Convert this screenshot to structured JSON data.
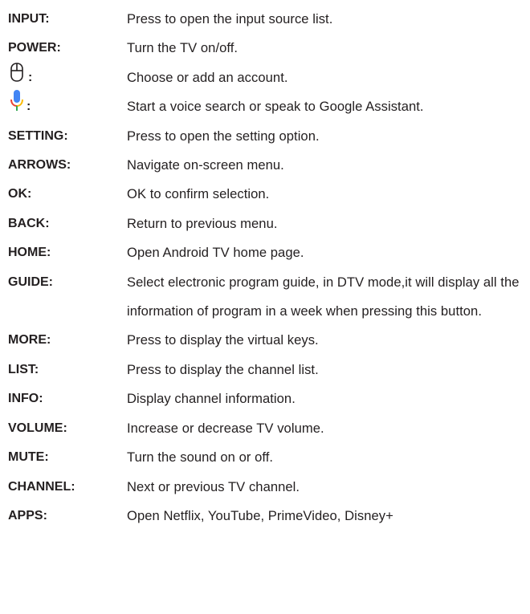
{
  "items": [
    {
      "term": "INPUT:",
      "desc": "Press to open the input source list."
    },
    {
      "term": "POWER:",
      "desc": "Turn the TV on/off."
    },
    {
      "term_icon": "account-icon",
      "term": ":",
      "desc": "Choose or add an account."
    },
    {
      "term_icon": "microphone-icon",
      "term": ":",
      "desc": "Start a voice search or speak to Google Assistant."
    },
    {
      "term": "SETTING:",
      "desc": "Press to open the setting option."
    },
    {
      "term": "ARROWS:",
      "desc": "Navigate on-screen menu."
    },
    {
      "term": "OK:",
      "desc": "OK to confirm selection."
    },
    {
      "term": "BACK:",
      "desc": "Return to previous menu."
    },
    {
      "term": "HOME:",
      "desc": "Open Android TV home page."
    },
    {
      "term": "GUIDE:",
      "desc": "Select electronic program guide, in DTV mode,it will display all the information of program in a week when pressing this button."
    },
    {
      "term": "MORE:",
      "desc": "Press to display the virtual keys."
    },
    {
      "term": "LIST:",
      "desc": "Press to display the channel list."
    },
    {
      "term": "INFO:",
      "desc": "Display channel information."
    },
    {
      "term": "VOLUME:",
      "desc": "Increase or decrease TV volume."
    },
    {
      "term": "MUTE:",
      "desc": "Turn the sound on or off."
    },
    {
      "term": "CHANNEL:",
      "desc": "Next or previous TV channel."
    },
    {
      "term": "APPS:",
      "desc": "Open Netflix, YouTube, PrimeVideo, Disney+"
    }
  ],
  "colors": {
    "text": "#231f20",
    "mic_blue": "#4285f4",
    "mic_red": "#ea4335",
    "mic_yellow": "#fbbc05",
    "mic_green": "#34a853"
  }
}
